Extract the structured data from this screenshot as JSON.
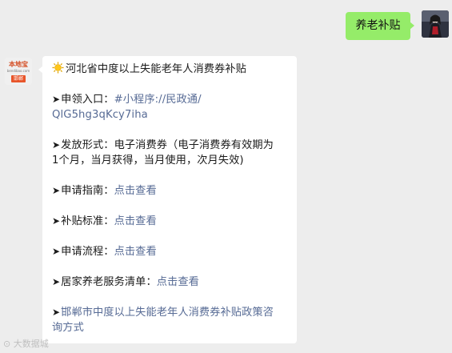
{
  "outgoing": {
    "text": "养老补贴"
  },
  "incoming_avatar": {
    "brand": "本地宝",
    "url": "bendibao.com",
    "city": "邯郸"
  },
  "message": {
    "title": "河北省中度以上失能老年人消费券补贴",
    "arrow": "➤",
    "apply_entry_label": "申领入口：",
    "apply_entry_link_1": "#小程序://民政通/",
    "apply_entry_link_2": "QlG5hg3qKcy7iha",
    "issue_form_label": "发放形式：",
    "issue_form_text_1": "电子消费券（电子消费券有效期为",
    "issue_form_text_2": "1个月，当月获得，当月使用，次月失效)",
    "guide_label": "申请指南：",
    "guide_link": "点击查看",
    "standard_label": "补贴标准：",
    "standard_link": "点击查看",
    "process_label": "申请流程：",
    "process_link": "点击查看",
    "service_list_label": "居家养老服务清单：",
    "service_list_link": "点击查看",
    "consult_link_1": "邯郸市中度以上失能老年人消费券补贴政策咨",
    "consult_link_2": "询方式"
  },
  "watermark": "⊙ 大数据城"
}
